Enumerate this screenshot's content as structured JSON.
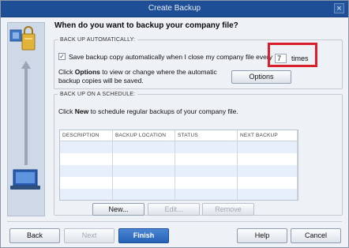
{
  "window": {
    "title": "Create Backup",
    "close_glyph": "×"
  },
  "question": "When do you want to backup your company file?",
  "auto_backup": {
    "legend": "BACK UP AUTOMATICALLY:",
    "checkbox_checked": true,
    "save_label": "Save backup copy automatically when I close my company file every",
    "times_value": "7",
    "times_label": "times",
    "options_text_pre": "Click ",
    "options_text_bold": "Options",
    "options_text_post": " to view or change where the automatic backup copies will be saved.",
    "options_button": "Options",
    "highlight_color": "#d81f2a"
  },
  "schedule": {
    "legend": "BACK UP ON A SCHEDULE:",
    "text_pre": "Click ",
    "text_bold": "New",
    "text_post": " to schedule regular backups of your company file.",
    "columns": [
      "DESCRIPTION",
      "BACKUP LOCATION",
      "STATUS",
      "NEXT BACKUP"
    ],
    "new_button": "New...",
    "edit_button": "Edit...",
    "remove_button": "Remove"
  },
  "footer": {
    "back": "Back",
    "next": "Next",
    "finish": "Finish",
    "help": "Help",
    "cancel": "Cancel"
  },
  "colors": {
    "titlebar": "#1e4f96",
    "primary_button": "#2561b6",
    "grid_alt_row": "#e6effa"
  }
}
